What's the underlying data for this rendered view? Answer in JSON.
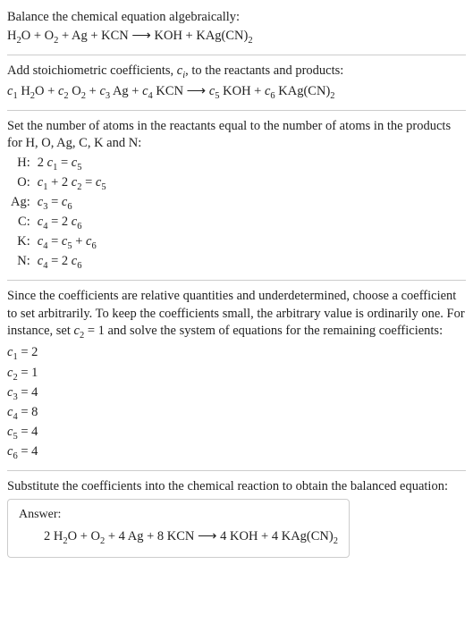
{
  "section1": {
    "title": "Balance the chemical equation algebraically:",
    "equation_html": "H<span class=\"sub\">2</span>O + O<span class=\"sub\">2</span> + Ag + KCN <span class=\"arrow\">⟶</span> KOH + KAg(CN)<span class=\"sub\">2</span>"
  },
  "section2": {
    "text_html": "Add stoichiometric coefficients, <span class=\"italic\">c</span><span class=\"italic-sub\">i</span>, to the reactants and products:",
    "equation_html": "<span class=\"italic\">c</span><span class=\"sub\">1</span> H<span class=\"sub\">2</span>O + <span class=\"italic\">c</span><span class=\"sub\">2</span> O<span class=\"sub\">2</span> + <span class=\"italic\">c</span><span class=\"sub\">3</span> Ag + <span class=\"italic\">c</span><span class=\"sub\">4</span> KCN <span class=\"arrow\">⟶</span> <span class=\"italic\">c</span><span class=\"sub\">5</span> KOH + <span class=\"italic\">c</span><span class=\"sub\">6</span> KAg(CN)<span class=\"sub\">2</span>"
  },
  "section3": {
    "intro": "Set the number of atoms in the reactants equal to the number of atoms in the products for H, O, Ag, C, K and N:",
    "rows": [
      {
        "label": "H:",
        "eq": "2 <span class=\"italic\">c</span><span class=\"sub\">1</span> = <span class=\"italic\">c</span><span class=\"sub\">5</span>"
      },
      {
        "label": "O:",
        "eq": "<span class=\"italic\">c</span><span class=\"sub\">1</span> + 2 <span class=\"italic\">c</span><span class=\"sub\">2</span> = <span class=\"italic\">c</span><span class=\"sub\">5</span>"
      },
      {
        "label": "Ag:",
        "eq": "<span class=\"italic\">c</span><span class=\"sub\">3</span> = <span class=\"italic\">c</span><span class=\"sub\">6</span>"
      },
      {
        "label": "C:",
        "eq": "<span class=\"italic\">c</span><span class=\"sub\">4</span> = 2 <span class=\"italic\">c</span><span class=\"sub\">6</span>"
      },
      {
        "label": "K:",
        "eq": "<span class=\"italic\">c</span><span class=\"sub\">4</span> = <span class=\"italic\">c</span><span class=\"sub\">5</span> + <span class=\"italic\">c</span><span class=\"sub\">6</span>"
      },
      {
        "label": "N:",
        "eq": "<span class=\"italic\">c</span><span class=\"sub\">4</span> = 2 <span class=\"italic\">c</span><span class=\"sub\">6</span>"
      }
    ]
  },
  "section4": {
    "intro_html": "Since the coefficients are relative quantities and underdetermined, choose a coefficient to set arbitrarily. To keep the coefficients small, the arbitrary value is ordinarily one. For instance, set <span class=\"italic\">c</span><span class=\"sub\">2</span> = 1 and solve the system of equations for the remaining coefficients:",
    "coeffs": [
      "<span class=\"italic\">c</span><span class=\"sub\">1</span> = 2",
      "<span class=\"italic\">c</span><span class=\"sub\">2</span> = 1",
      "<span class=\"italic\">c</span><span class=\"sub\">3</span> = 4",
      "<span class=\"italic\">c</span><span class=\"sub\">4</span> = 8",
      "<span class=\"italic\">c</span><span class=\"sub\">5</span> = 4",
      "<span class=\"italic\">c</span><span class=\"sub\">6</span> = 4"
    ]
  },
  "section5": {
    "intro": "Substitute the coefficients into the chemical reaction to obtain the balanced equation:",
    "answer_label": "Answer:",
    "answer_html": "2 H<span class=\"sub\">2</span>O + O<span class=\"sub\">2</span> + 4 Ag + 8 KCN <span class=\"arrow\">⟶</span> 4 KOH + 4 KAg(CN)<span class=\"sub\">2</span>"
  }
}
